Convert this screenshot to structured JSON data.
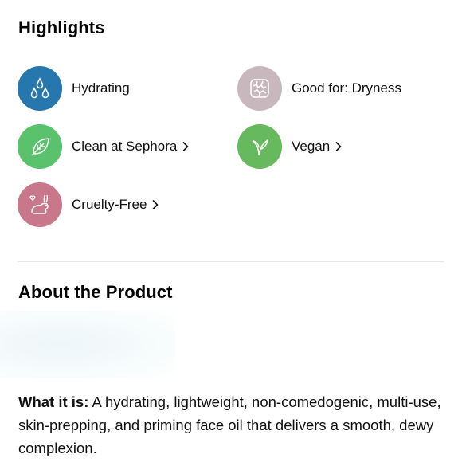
{
  "highlights": {
    "title": "Highlights",
    "items": [
      {
        "label": "Hydrating",
        "icon": "water-drops-icon",
        "color": "#2677ad",
        "link": false
      },
      {
        "label": "Good for: Dryness",
        "icon": "dry-skin-icon",
        "color": "#c8b7bd",
        "link": false
      },
      {
        "label": "Clean at Sephora",
        "icon": "leaf-icon",
        "color": "#5ac26c",
        "link": true
      },
      {
        "label": "Vegan",
        "icon": "sprout-icon",
        "color": "#67b95d",
        "link": true
      },
      {
        "label": "Cruelty-Free",
        "icon": "rabbit-heart-icon",
        "color": "#c9788b",
        "link": true
      }
    ]
  },
  "about": {
    "title": "About the Product",
    "what_it_is_label": "What it is:",
    "what_it_is_text": " A hydrating, lightweight, non-comedogenic, multi-use, skin-prepping, and priming face oil that delivers a smooth, dewy complexion."
  }
}
